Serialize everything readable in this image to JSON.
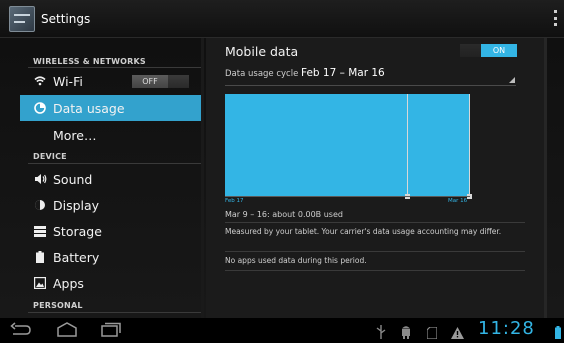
{
  "app": {
    "title": "Settings"
  },
  "sidebar": {
    "sections": [
      {
        "header": "WIRELESS & NETWORKS"
      },
      {
        "header": "DEVICE"
      },
      {
        "header": "PERSONAL"
      }
    ],
    "items": [
      {
        "label": "Wi-Fi",
        "icon": "wifi-icon",
        "toggle": "OFF"
      },
      {
        "label": "Data usage",
        "icon": "data-usage-icon",
        "selected": true
      },
      {
        "label": "More…"
      },
      {
        "label": "Sound",
        "icon": "sound-icon"
      },
      {
        "label": "Display",
        "icon": "display-icon"
      },
      {
        "label": "Storage",
        "icon": "storage-icon"
      },
      {
        "label": "Battery",
        "icon": "battery-icon"
      },
      {
        "label": "Apps",
        "icon": "apps-icon"
      }
    ]
  },
  "detail": {
    "title": "Mobile data",
    "toggle": "ON",
    "cycle_label": "Data usage cycle",
    "cycle_value": "Feb 17 – Mar 16",
    "chart_start_label": "Feb 17",
    "chart_end_label": "Mar 16",
    "summary": "Mar 9 – 16: about 0.00B used",
    "note": "Measured by your tablet. Your carrier's data usage accounting may differ.",
    "empty": "No apps used data during this period."
  },
  "system": {
    "clock": "11:28"
  },
  "colors": {
    "accent": "#33b5e5",
    "selected_item": "#33a2cd",
    "background": "#000000"
  }
}
